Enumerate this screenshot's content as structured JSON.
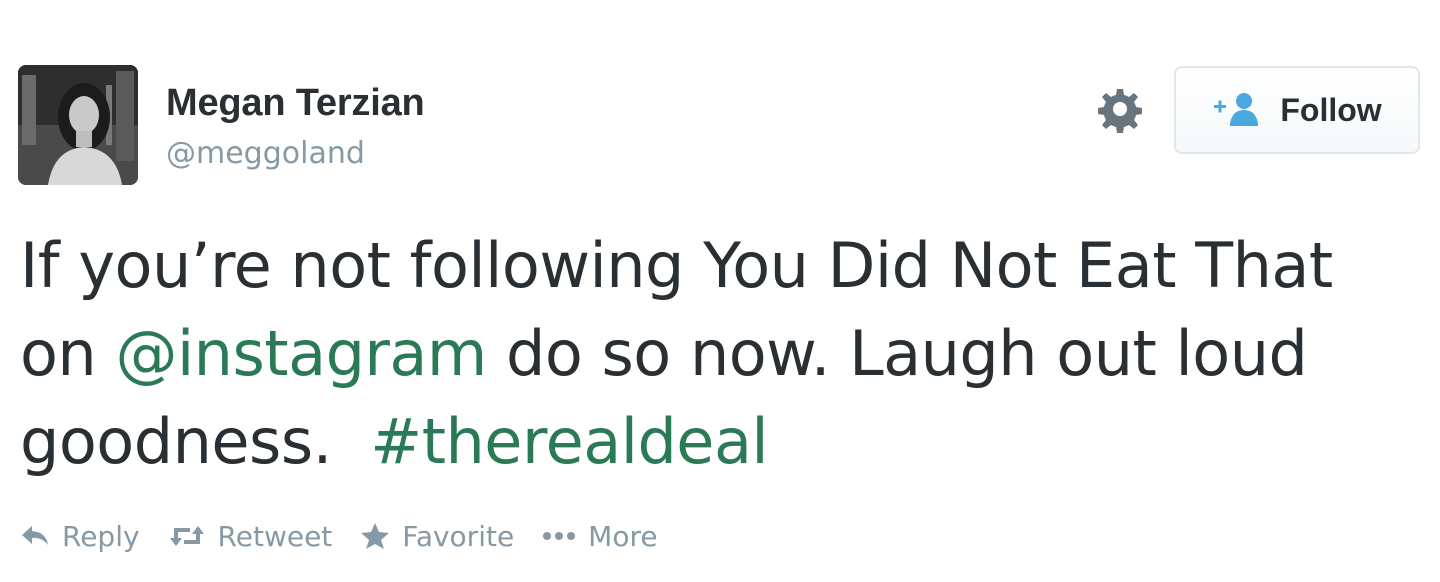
{
  "user": {
    "full_name": "Megan Terzian",
    "handle": "@meggoland"
  },
  "follow_button": {
    "label": "Follow",
    "icon": "add-user-icon"
  },
  "settings": {
    "icon": "gear-icon"
  },
  "tweet": {
    "text_part1": "If you’re not following You Did Not Eat That on ",
    "mention": "@instagram",
    "text_part2": " do so now. Laugh out loud goodness.  ",
    "hashtag": "#therealdeal"
  },
  "actions": [
    {
      "label": "Reply",
      "icon": "reply-icon"
    },
    {
      "label": "Retweet",
      "icon": "retweet-icon"
    },
    {
      "label": "Favorite",
      "icon": "star-icon"
    },
    {
      "label": "More",
      "icon": "more-dots-icon"
    }
  ],
  "colors": {
    "link": "#2b7a57",
    "text": "#292f33",
    "muted": "#8899a6",
    "follow_icon": "#4aa7e0"
  }
}
